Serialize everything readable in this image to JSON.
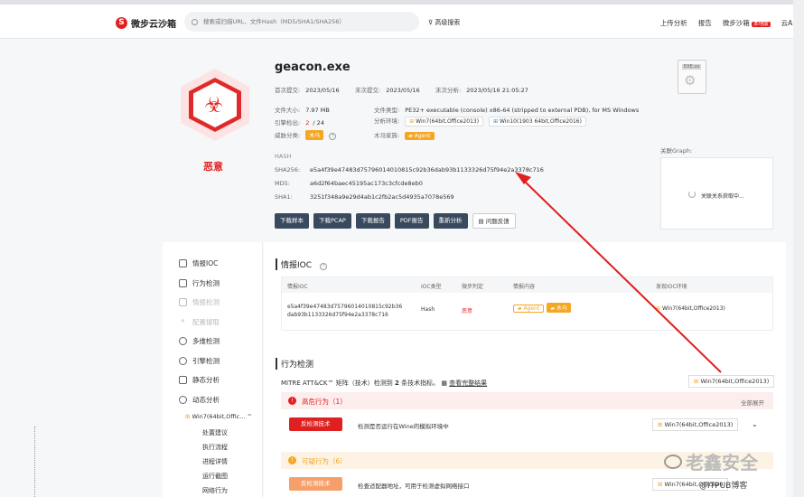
{
  "header": {
    "logo_text": "微步云沙箱",
    "search_placeholder": "搜索或扫描URL、文件Hash（MD5/SHA1/SHA256）",
    "advanced_search": "高级搜索",
    "nav": [
      "上传分析",
      "报告",
      "微步沙箱",
      "云API"
    ],
    "nav_badge": "本地版"
  },
  "summary": {
    "filename": "geacon.exe",
    "verdict": "恶意",
    "first_submit_label": "首次提交:",
    "first_submit": "2023/05/16",
    "last_submit_label": "末次提交:",
    "last_submit": "2023/05/16",
    "last_analysis_label": "末次分析:",
    "last_analysis": "2023/05/16 21:05:27",
    "file_size_label": "文件大小:",
    "file_size": "7.97 MB",
    "file_type_label": "文件类型:",
    "file_type": "PE32+ executable (console) x86-64 (stripped to external PDB), for MS Windows",
    "engine_label": "引擎检出:",
    "engine_hits": "2",
    "engine_total": "/ 24",
    "analysis_env_label": "分析环境:",
    "env1": "Win7(64bit,Office2013)",
    "env2": "Win10(1903 64bit,Office2016)",
    "threat_label": "威胁分类:",
    "threat_type": "木马",
    "family_label": "木马家族:",
    "family": "Agent",
    "doc_label": "EXE.co",
    "graph_label": "关联Graph:",
    "graph_loading": "关联关系获取中..."
  },
  "hashes": {
    "title": "HASH",
    "sha256_label": "SHA256:",
    "sha256": "e5a4f39e47483d75796014010815c92b36dab93b1133326d75f94e2a3378c716",
    "md5_label": "MD5:",
    "md5": "a6d2f64baec45195ac173c3cfcde8eb0",
    "sha1_label": "SHA1:",
    "sha1": "3251f348a9e29d4ab1c2fb2ac5d4935a7078e569"
  },
  "buttons": [
    "下载样本",
    "下载PCAP",
    "下载报告",
    "PDF报告",
    "重新分析",
    "问题反馈"
  ],
  "sidebar": {
    "items": [
      "情报IOC",
      "行为检测",
      "情报检测",
      "配置提取",
      "多维检测",
      "引擎检测",
      "静态分析",
      "动态分析"
    ],
    "env": "Win7(64bit,Offic...",
    "sub_items": [
      "处置建议",
      "执行流程",
      "进程详情",
      "运行截图",
      "网络行为"
    ]
  },
  "ioc": {
    "title": "情报IOC",
    "headers": [
      "情报IOC",
      "IOC类型",
      "微步判定",
      "情报内容",
      "发现IOC环境"
    ],
    "row": {
      "ioc_line1": "e5a4f39e47483d75796014010815c92b36",
      "ioc_line2": "dab93b1133326d75f94e2a3378c716",
      "type": "Hash",
      "verdict": "恶意",
      "tag1": "Agent",
      "tag2": "木马",
      "env": "Win7(64bit,Office2013)"
    }
  },
  "behavior": {
    "title": "行为检测",
    "mitre_prefix": "MITRE ATT&CK™ 矩阵（技术）检测到",
    "mitre_count": "2",
    "mitre_suffix": "条技术指标。",
    "mitre_link": "查看完整结果",
    "env": "Win7(64bit,Office2013)",
    "high_title": "高危行为（1）",
    "expand_all": "全部展开",
    "high_tag": "反检测技术",
    "high_text": "检测是否运行在Wine的模拟环境中",
    "high_env": "Win7(64bit,Office2013)",
    "susp_title": "可疑行为（6）",
    "susp_tag": "反检测技术",
    "susp_text": "检查适配器地址，可用于检测虚拟网络接口",
    "susp_env": "Win7(64bit,Office20"
  },
  "watermark": {
    "text": "老鑫安全",
    "small": "@ITPUB博客"
  },
  "colors": {
    "malicious": "#e02020",
    "warning": "#f5a623",
    "dark_button": "#3a4a5e"
  }
}
